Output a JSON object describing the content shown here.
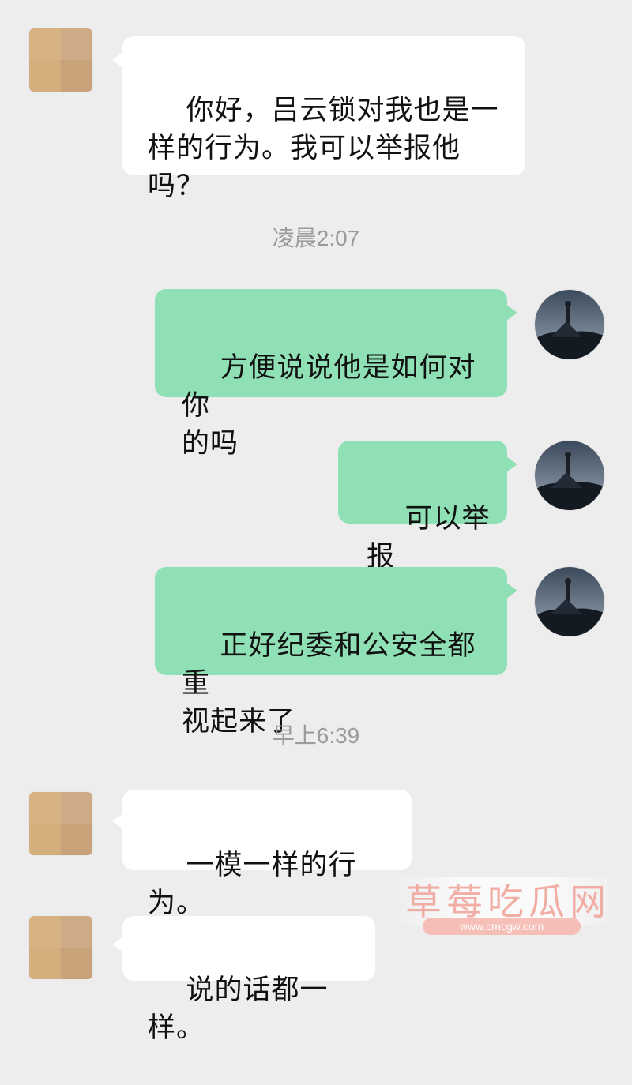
{
  "messages": [
    {
      "text": "你好，吕云锁对我也是一\n样的行为。我可以举报他\n吗？"
    },
    {
      "text": "方便说说他是如何对你\n的吗"
    },
    {
      "text": "可以举报"
    },
    {
      "text": "正好纪委和公安全都重\n视起来了"
    },
    {
      "text": "一模一样的行为。"
    },
    {
      "text": "说的话都一样。"
    }
  ],
  "timestamps": [
    "凌晨2:07",
    "早上6:39"
  ],
  "watermark": {
    "title": "草莓吃瓜网",
    "url": "www.cmcgw.com"
  },
  "colors": {
    "background": "#ededed",
    "incoming_bubble": "#ffffff",
    "outgoing_bubble": "#8fe0b4",
    "timestamp": "#9b9b9b"
  },
  "icons": {
    "incoming_avatar": "blurred-avatar",
    "outgoing_avatar": "lighthouse-avatar"
  }
}
